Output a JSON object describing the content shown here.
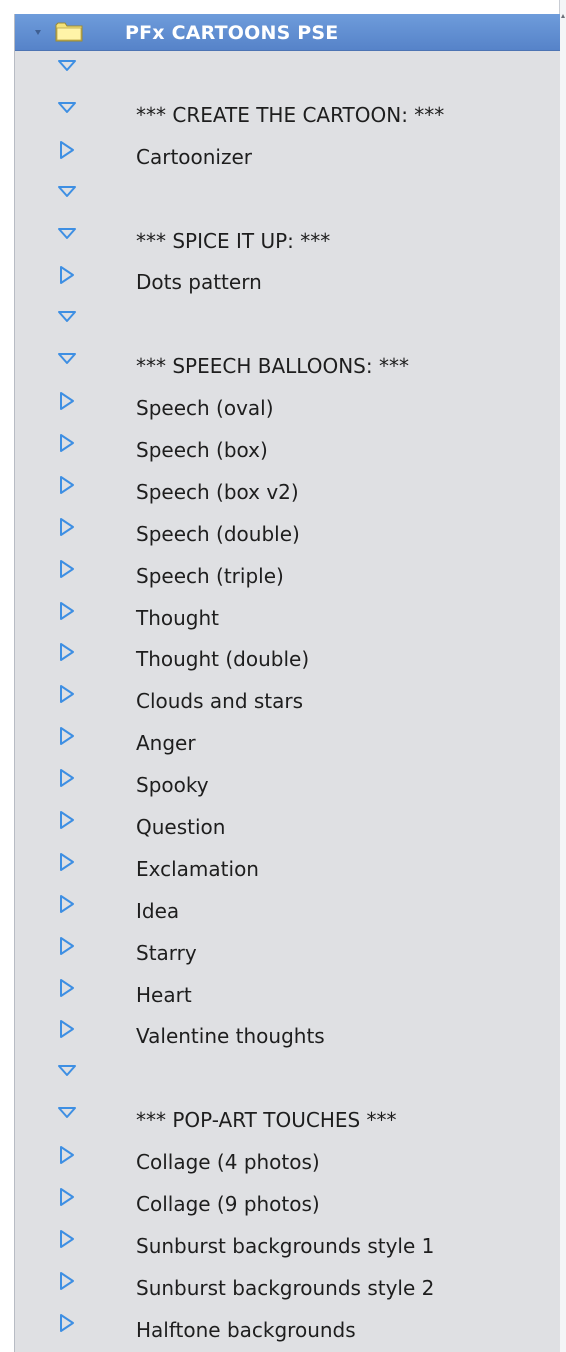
{
  "header": {
    "title": "PFx CARTOONS PSE",
    "icon": "folder-icon",
    "accent_color": "#5f8fd3"
  },
  "colors": {
    "panel_bg": "#dfe0e3",
    "arrow_color": "#3e8fe3",
    "text_color": "#1e1e1e"
  },
  "items": [
    {
      "label": "",
      "state": "expanded"
    },
    {
      "label": "*** CREATE THE CARTOON: ***",
      "state": "expanded"
    },
    {
      "label": "Cartoonizer",
      "state": "collapsed"
    },
    {
      "label": "",
      "state": "expanded"
    },
    {
      "label": "*** SPICE IT UP: ***",
      "state": "expanded"
    },
    {
      "label": "Dots pattern",
      "state": "collapsed"
    },
    {
      "label": "",
      "state": "expanded"
    },
    {
      "label": "*** SPEECH BALLOONS: ***",
      "state": "expanded"
    },
    {
      "label": "Speech (oval)",
      "state": "collapsed"
    },
    {
      "label": "Speech (box)",
      "state": "collapsed"
    },
    {
      "label": "Speech (box v2)",
      "state": "collapsed"
    },
    {
      "label": "Speech (double)",
      "state": "collapsed"
    },
    {
      "label": "Speech (triple)",
      "state": "collapsed"
    },
    {
      "label": "Thought",
      "state": "collapsed"
    },
    {
      "label": "Thought (double)",
      "state": "collapsed"
    },
    {
      "label": "Clouds and stars",
      "state": "collapsed"
    },
    {
      "label": "Anger",
      "state": "collapsed"
    },
    {
      "label": "Spooky",
      "state": "collapsed"
    },
    {
      "label": "Question",
      "state": "collapsed"
    },
    {
      "label": "Exclamation",
      "state": "collapsed"
    },
    {
      "label": "Idea",
      "state": "collapsed"
    },
    {
      "label": "Starry",
      "state": "collapsed"
    },
    {
      "label": "Heart",
      "state": "collapsed"
    },
    {
      "label": "Valentine thoughts",
      "state": "collapsed"
    },
    {
      "label": "",
      "state": "expanded"
    },
    {
      "label": "*** POP-ART  TOUCHES ***",
      "state": "expanded"
    },
    {
      "label": "Collage (4 photos)",
      "state": "collapsed"
    },
    {
      "label": "Collage (9 photos)",
      "state": "collapsed"
    },
    {
      "label": "Sunburst backgrounds style 1",
      "state": "collapsed"
    },
    {
      "label": "Sunburst backgrounds style 2",
      "state": "collapsed"
    },
    {
      "label": "Halftone backgrounds",
      "state": "collapsed"
    }
  ]
}
